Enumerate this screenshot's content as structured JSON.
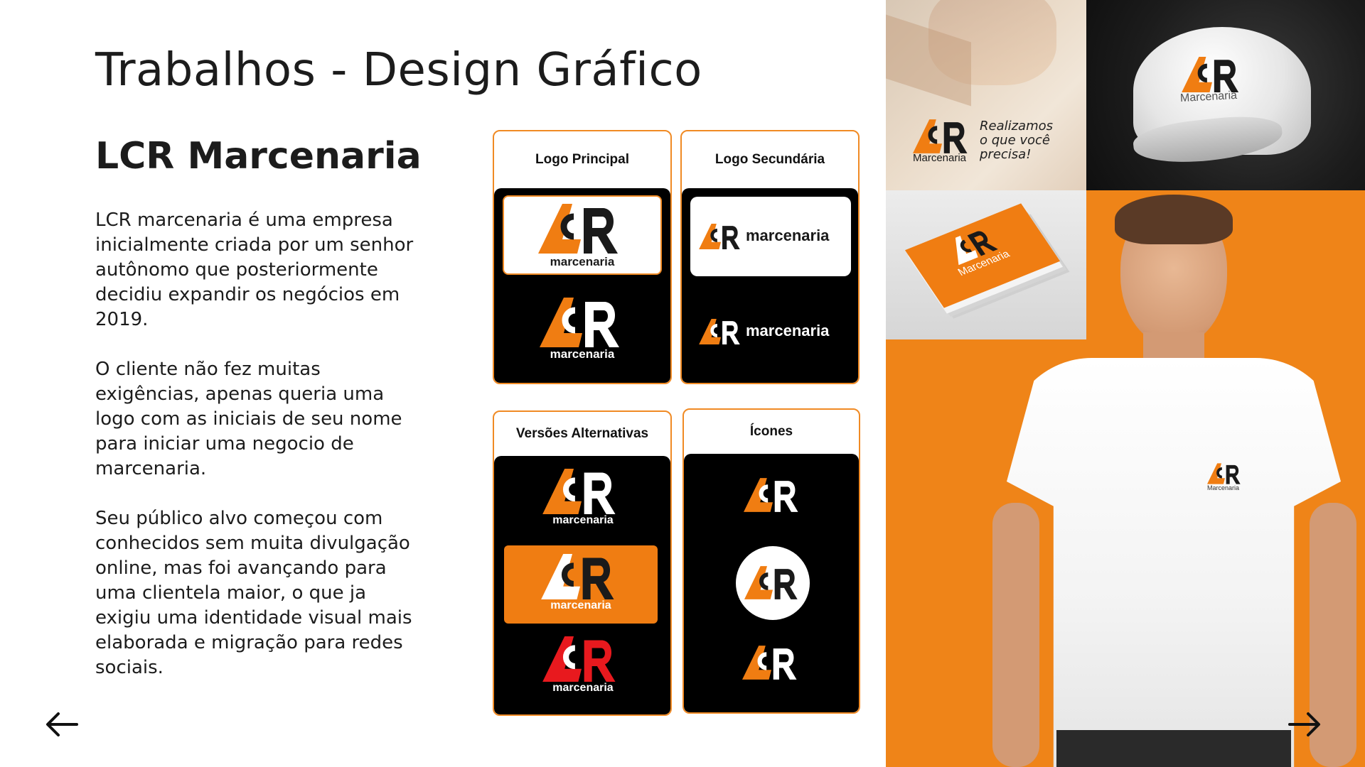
{
  "header": {
    "title": "Trabalhos - Design Gráfico",
    "subtitle": "LCR Marcenaria"
  },
  "description": [
    "LCR marcenaria é uma empresa inicialmente criada por um senhor autônomo que posteriormente decidiu expandir os negócios em 2019.",
    "O cliente não fez muitas exigências, apenas queria uma logo com as iniciais  de seu nome para iniciar uma negocio de marcenaria.",
    "Seu público alvo começou com conhecidos sem muita divulgação online, mas foi avançando para uma clientela maior, o que ja exigiu uma identidade visual mais elaborada e migração para redes sociais."
  ],
  "cards": {
    "primary_logo": "Logo Principal",
    "secondary_logo": "Logo Secundária",
    "alternative_versions": "Versões Alternativas",
    "icons": "Ícones"
  },
  "brand": {
    "wordmark": "marcenaria",
    "wordmark_title": "Marcenaria",
    "tagline": [
      "Realizamos",
      "o que você",
      "precisa!"
    ]
  },
  "navigation": {
    "prev_icon": "arrow-left-icon",
    "next_icon": "arrow-right-icon"
  },
  "colors": {
    "accent": "#f08a24",
    "orange": "#f07d12",
    "dark": "#1a1a1a",
    "red": "#e8191e"
  }
}
